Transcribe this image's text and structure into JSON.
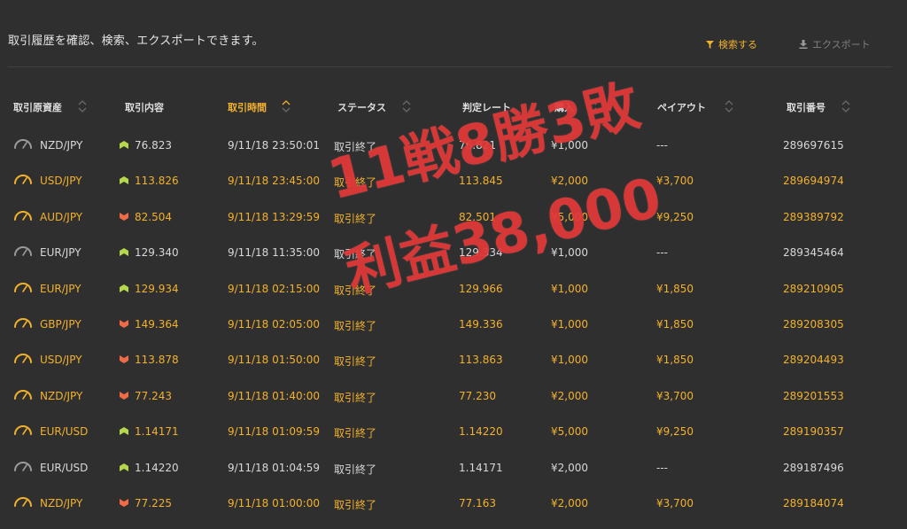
{
  "intro": "取引履歴を確認、検索、エクスポートできます。",
  "toolbar": {
    "search_label": "検索する",
    "export_label": "エクスポート"
  },
  "columns": [
    "取引原資産",
    "取引内容",
    "取引時間",
    "ステータス",
    "判定レート",
    "購入",
    "ペイアウト",
    "取引番号"
  ],
  "rows": [
    {
      "asset": "NZD/JPY",
      "dir": "up",
      "rate": "76.823",
      "time": "9/11/18 23:50:01",
      "status": "取引終了",
      "judge": "76.821",
      "purchase": "¥1,000",
      "payout": "---",
      "id": "289697615",
      "win": false
    },
    {
      "asset": "USD/JPY",
      "dir": "up",
      "rate": "113.826",
      "time": "9/11/18 23:45:00",
      "status": "取引終了",
      "judge": "113.845",
      "purchase": "¥2,000",
      "payout": "¥3,700",
      "id": "289694974",
      "win": true
    },
    {
      "asset": "AUD/JPY",
      "dir": "down",
      "rate": "82.504",
      "time": "9/11/18 13:29:59",
      "status": "取引終了",
      "judge": "82.501",
      "purchase": "¥5,000",
      "payout": "¥9,250",
      "id": "289389792",
      "win": true
    },
    {
      "asset": "EUR/JPY",
      "dir": "up",
      "rate": "129.340",
      "time": "9/11/18 11:35:00",
      "status": "取引終了",
      "judge": "129.334",
      "purchase": "¥1,000",
      "payout": "---",
      "id": "289345464",
      "win": false
    },
    {
      "asset": "EUR/JPY",
      "dir": "up",
      "rate": "129.934",
      "time": "9/11/18 02:15:00",
      "status": "取引終了",
      "judge": "129.966",
      "purchase": "¥1,000",
      "payout": "¥1,850",
      "id": "289210905",
      "win": true
    },
    {
      "asset": "GBP/JPY",
      "dir": "down",
      "rate": "149.364",
      "time": "9/11/18 02:05:00",
      "status": "取引終了",
      "judge": "149.336",
      "purchase": "¥1,000",
      "payout": "¥1,850",
      "id": "289208305",
      "win": true
    },
    {
      "asset": "USD/JPY",
      "dir": "down",
      "rate": "113.878",
      "time": "9/11/18 01:50:00",
      "status": "取引終了",
      "judge": "113.863",
      "purchase": "¥1,000",
      "payout": "¥1,850",
      "id": "289204493",
      "win": true
    },
    {
      "asset": "NZD/JPY",
      "dir": "down",
      "rate": "77.243",
      "time": "9/11/18 01:40:00",
      "status": "取引終了",
      "judge": "77.230",
      "purchase": "¥2,000",
      "payout": "¥3,700",
      "id": "289201553",
      "win": true
    },
    {
      "asset": "EUR/USD",
      "dir": "up",
      "rate": "1.14171",
      "time": "9/11/18 01:09:59",
      "status": "取引終了",
      "judge": "1.14220",
      "purchase": "¥5,000",
      "payout": "¥9,250",
      "id": "289190357",
      "win": true
    },
    {
      "asset": "EUR/USD",
      "dir": "up",
      "rate": "1.14220",
      "time": "9/11/18 01:04:59",
      "status": "取引終了",
      "judge": "1.14171",
      "purchase": "¥2,000",
      "payout": "---",
      "id": "289187496",
      "win": false
    },
    {
      "asset": "NZD/JPY",
      "dir": "down",
      "rate": "77.225",
      "time": "9/11/18 01:00:00",
      "status": "取引終了",
      "judge": "77.163",
      "purchase": "¥2,000",
      "payout": "¥3,700",
      "id": "289184074",
      "win": true
    }
  ],
  "overlay": {
    "line1": "11戦8勝3敗",
    "line2": "利益38,000"
  },
  "colors": {
    "accent": "#f2b12d",
    "up_arrow": "#b4d84a",
    "down_arrow": "#f06a46",
    "overlay_text": "#e33838",
    "background": "#2f2f2f"
  }
}
